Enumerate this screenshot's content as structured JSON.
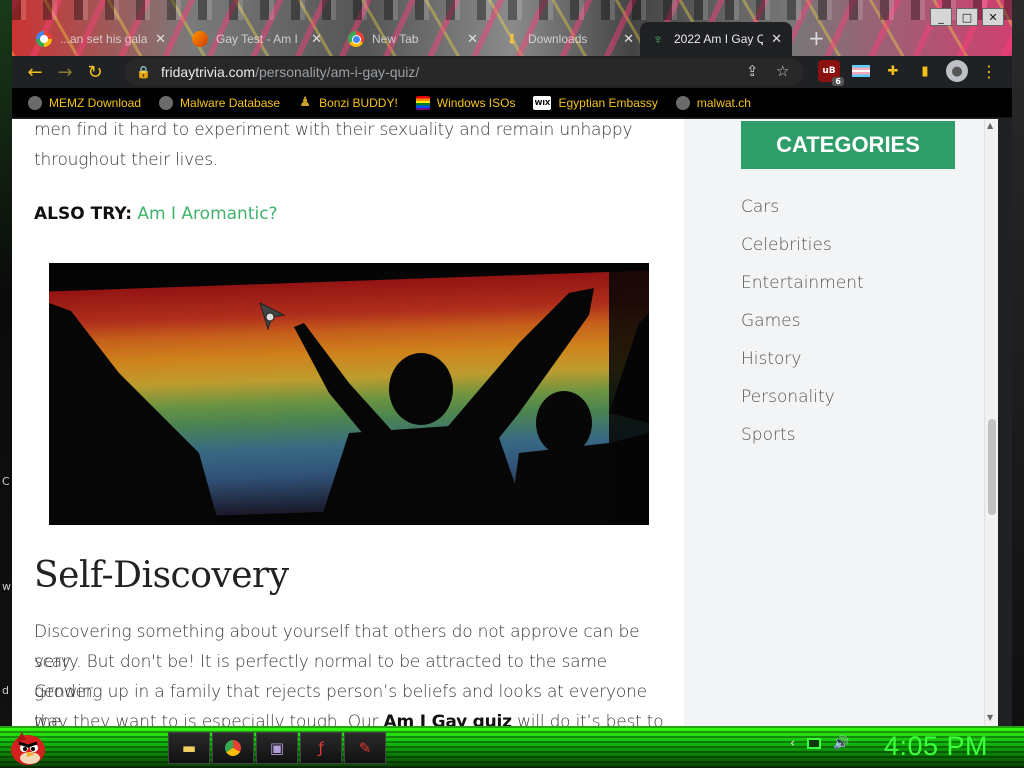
{
  "desktop": {
    "left_letters": [
      "C",
      "w",
      "d"
    ]
  },
  "window": {
    "controls": [
      "_",
      "□",
      "✕"
    ]
  },
  "tabs": [
    {
      "title": "...an set his gala...",
      "icon": "google-icon"
    },
    {
      "title": "Gay Test - Am I",
      "icon": "firefox-icon"
    },
    {
      "title": "New Tab",
      "icon": "chrome-icon"
    },
    {
      "title": "Downloads",
      "icon": "download-icon"
    },
    {
      "title": "2022 Am I Gay Q",
      "icon": "site-icon",
      "active": true
    }
  ],
  "toolbar": {
    "url_domain": "fridaytrivia.com",
    "url_path": "/personality/am-i-gay-quiz/",
    "ublock_badge": "6"
  },
  "bookmarks": [
    {
      "label": "MEMZ Download",
      "icon": "globe-icon"
    },
    {
      "label": "Malware Database",
      "icon": "globe-icon"
    },
    {
      "label": "Bonzi BUDDY!",
      "icon": "bonzi-icon"
    },
    {
      "label": "Windows ISOs",
      "icon": "rainbow-flag-icon"
    },
    {
      "label": "Egyptian Embassy",
      "icon": "wix-icon"
    },
    {
      "label": "malwat.ch",
      "icon": "globe-icon"
    }
  ],
  "article": {
    "intro_line1": "men find it hard to experiment with their sexuality and remain unhappy",
    "intro_line2": "throughout their lives.",
    "also_try_label": "ALSO TRY:",
    "also_try_link": "Am I Aromantic?",
    "section_title": "Self-Discovery",
    "para_line1": "Discovering something about yourself that others do not approve can be very",
    "para_line2": "scary. But don't be! It is perfectly normal to be attracted to the same gender.",
    "para_line3": "Growing up in a family that rejects person’s beliefs and looks at everyone the",
    "para_line4_start": "way they want to is especially tough. Our",
    "para_line4_bold": "Am I Gay quiz",
    "para_line4_end": "will do it’s best to"
  },
  "sidebar": {
    "header": "CATEGORIES",
    "categories": [
      "Cars",
      "Celebrities",
      "Entertainment",
      "Games",
      "History",
      "Personality",
      "Sports"
    ]
  },
  "taskbar": {
    "clock": "4:05 PM"
  },
  "colors": {
    "accent_green": "#2e9d6a",
    "link_green": "#3fb36b",
    "toolbar_yellow": "#f5c21b",
    "clock_green": "#3dff3d"
  }
}
